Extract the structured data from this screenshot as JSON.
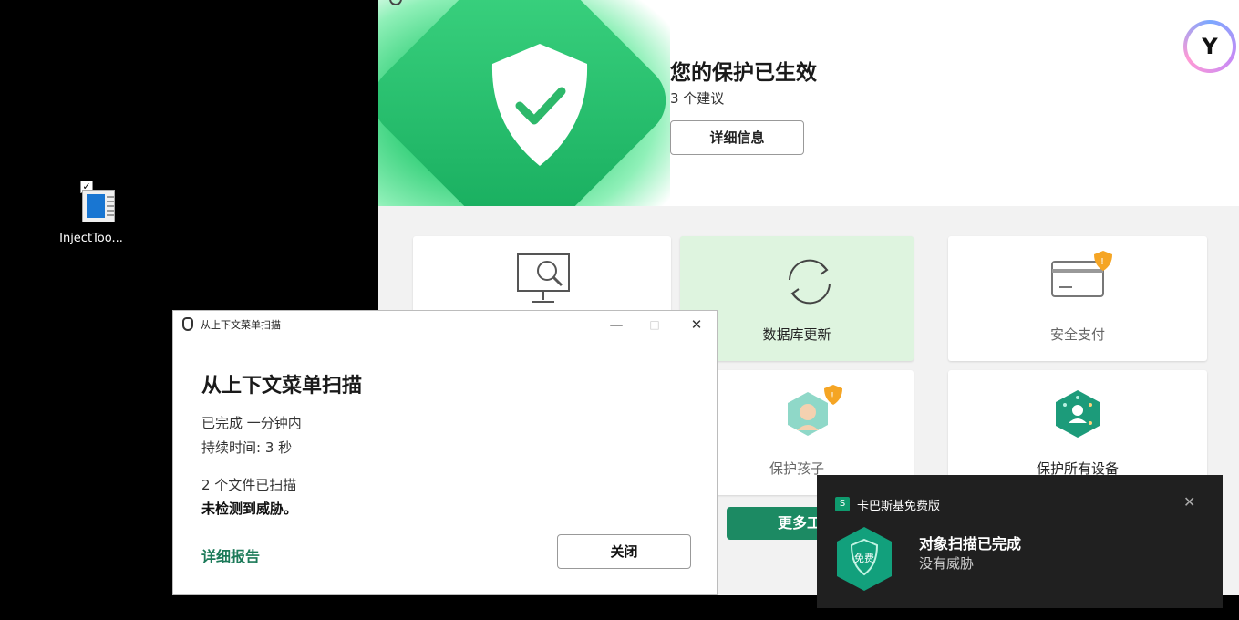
{
  "desktop": {
    "icon_label": "InjectToo..."
  },
  "main": {
    "status_title": "您的保护已生效",
    "recommendations": "3 个建议",
    "detail_button": "详细信息",
    "tiles": [
      {
        "label": "",
        "icon": "scan-monitor-icon"
      },
      {
        "label": "数据库更新",
        "icon": "refresh-icon"
      },
      {
        "label": "安全支付",
        "icon": "card-icon"
      },
      {
        "label": "保护孩子",
        "icon": "child-icon"
      },
      {
        "label": "保护所有设备",
        "icon": "devices-icon"
      }
    ],
    "more_button": "更多工",
    "accent_color": "#1c8a63"
  },
  "dialog": {
    "window_title": "从上下文菜单扫描",
    "heading": "从上下文菜单扫描",
    "completed": "已完成 一分钟内",
    "duration": "持续时间: 3 秒",
    "files_scanned": "2 个文件已扫描",
    "result": "未检测到威胁。",
    "report_link": "详细报告",
    "close_button": "关闭"
  },
  "toast": {
    "app_name": "卡巴斯基免费版",
    "badge_text": "免费",
    "title": "对象扫描已完成",
    "subtitle": "没有威胁"
  }
}
